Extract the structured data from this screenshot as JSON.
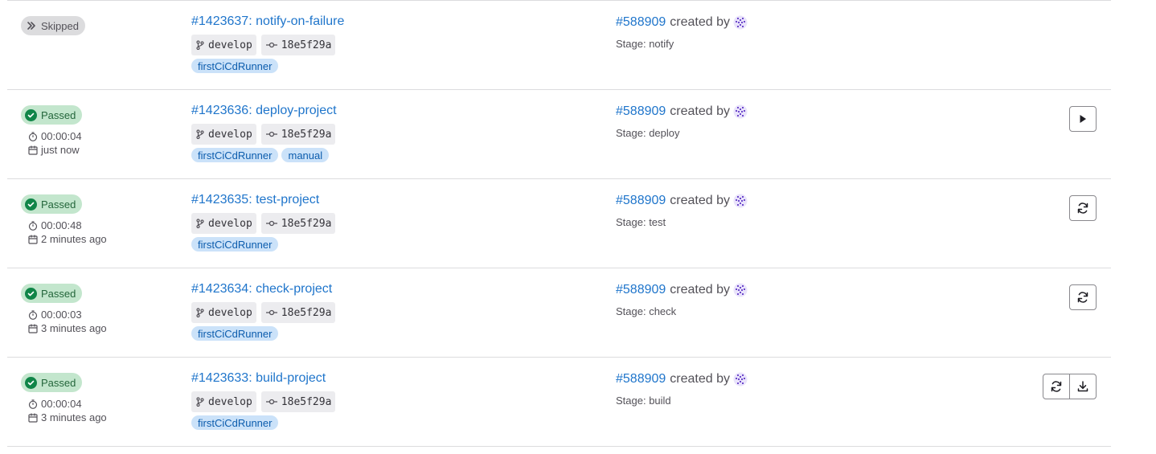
{
  "jobs": [
    {
      "status": "Skipped",
      "status_kind": "skipped",
      "duration": "",
      "finished": "",
      "title": "#1423637: notify-on-failure",
      "branch": "develop",
      "commit": "18e5f29a",
      "tags": [
        "firstCiCdRunner"
      ],
      "pipeline": "#588909",
      "created_by": "created by",
      "stage": "Stage: notify",
      "actions": []
    },
    {
      "status": "Passed",
      "status_kind": "passed",
      "duration": "00:00:04",
      "finished": "just now",
      "title": "#1423636: deploy-project",
      "branch": "develop",
      "commit": "18e5f29a",
      "tags": [
        "firstCiCdRunner",
        "manual"
      ],
      "pipeline": "#588909",
      "created_by": "created by",
      "stage": "Stage: deploy",
      "actions": [
        "play-icon"
      ]
    },
    {
      "status": "Passed",
      "status_kind": "passed",
      "duration": "00:00:48",
      "finished": "2 minutes ago",
      "title": "#1423635: test-project",
      "branch": "develop",
      "commit": "18e5f29a",
      "tags": [
        "firstCiCdRunner"
      ],
      "pipeline": "#588909",
      "created_by": "created by",
      "stage": "Stage: test",
      "actions": [
        "retry-icon"
      ]
    },
    {
      "status": "Passed",
      "status_kind": "passed",
      "duration": "00:00:03",
      "finished": "3 minutes ago",
      "title": "#1423634: check-project",
      "branch": "develop",
      "commit": "18e5f29a",
      "tags": [
        "firstCiCdRunner"
      ],
      "pipeline": "#588909",
      "created_by": "created by",
      "stage": "Stage: check",
      "actions": [
        "retry-icon"
      ]
    },
    {
      "status": "Passed",
      "status_kind": "passed",
      "duration": "00:00:04",
      "finished": "3 minutes ago",
      "title": "#1423633: build-project",
      "branch": "develop",
      "commit": "18e5f29a",
      "tags": [
        "firstCiCdRunner"
      ],
      "pipeline": "#588909",
      "created_by": "created by",
      "stage": "Stage: build",
      "actions": [
        "retry-icon",
        "download-icon"
      ]
    }
  ],
  "colors": {
    "link": "#1f75cb",
    "passed_bg": "#c3e6cd",
    "passed_icon": "#108548",
    "skipped_bg": "#dcdcde",
    "tag_bg": "#cbe2f9",
    "chip_bg": "#ececef"
  }
}
